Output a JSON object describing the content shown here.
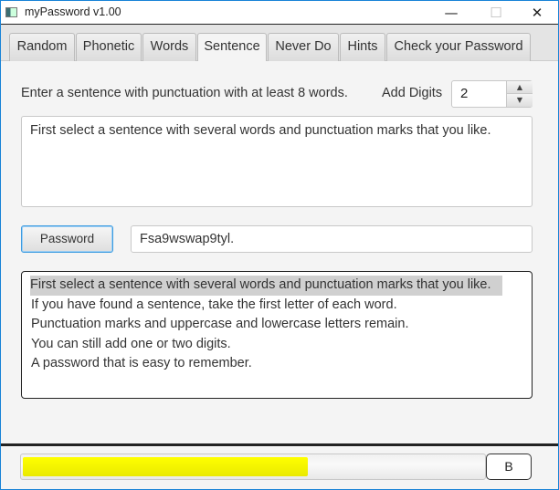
{
  "window": {
    "title": "myPassword   v1.00",
    "minimize": "—",
    "maximize": "☐",
    "close": "✕"
  },
  "tabs": [
    {
      "label": "Random"
    },
    {
      "label": "Phonetic"
    },
    {
      "label": "Words"
    },
    {
      "label": "Sentence"
    },
    {
      "label": "Never Do"
    },
    {
      "label": "Hints"
    },
    {
      "label": "Check your Password"
    }
  ],
  "selected_tab": "Sentence",
  "main": {
    "instruction": "Enter a sentence with punctuation with at least 8 words.",
    "add_digits_label": "Add Digits",
    "add_digits_value": "2",
    "sentence_input": "First select a sentence with several words and punctuation marks that you like.",
    "password_button": "Password",
    "password_output": "Fsa9wswap9tyl.",
    "info_lines": [
      "First select a sentence with several words and punctuation marks that you like.",
      "If you have found a sentence, take the first letter of each word.",
      "Punctuation marks and uppercase and lowercase letters remain.",
      "You can still add one or two digits.",
      "A password that is easy to remember."
    ]
  },
  "strength": {
    "progress": 0.62,
    "color": "#ffff00",
    "grade": "B"
  }
}
